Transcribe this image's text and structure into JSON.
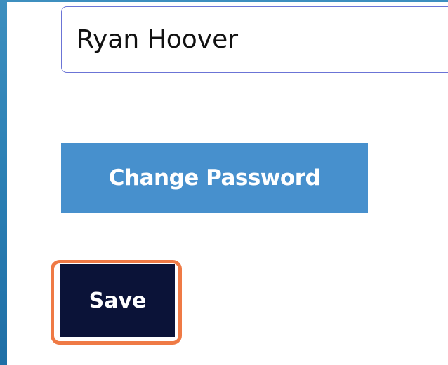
{
  "form": {
    "name_value": "Ryan Hoover",
    "change_password_label": "Change Password",
    "save_label": "Save"
  },
  "colors": {
    "background": "#2a7fb4",
    "change_password_button": "#4790cd",
    "save_button": "#0b1338",
    "highlight": "#ef7a45",
    "input_border": "#6b74d6"
  }
}
